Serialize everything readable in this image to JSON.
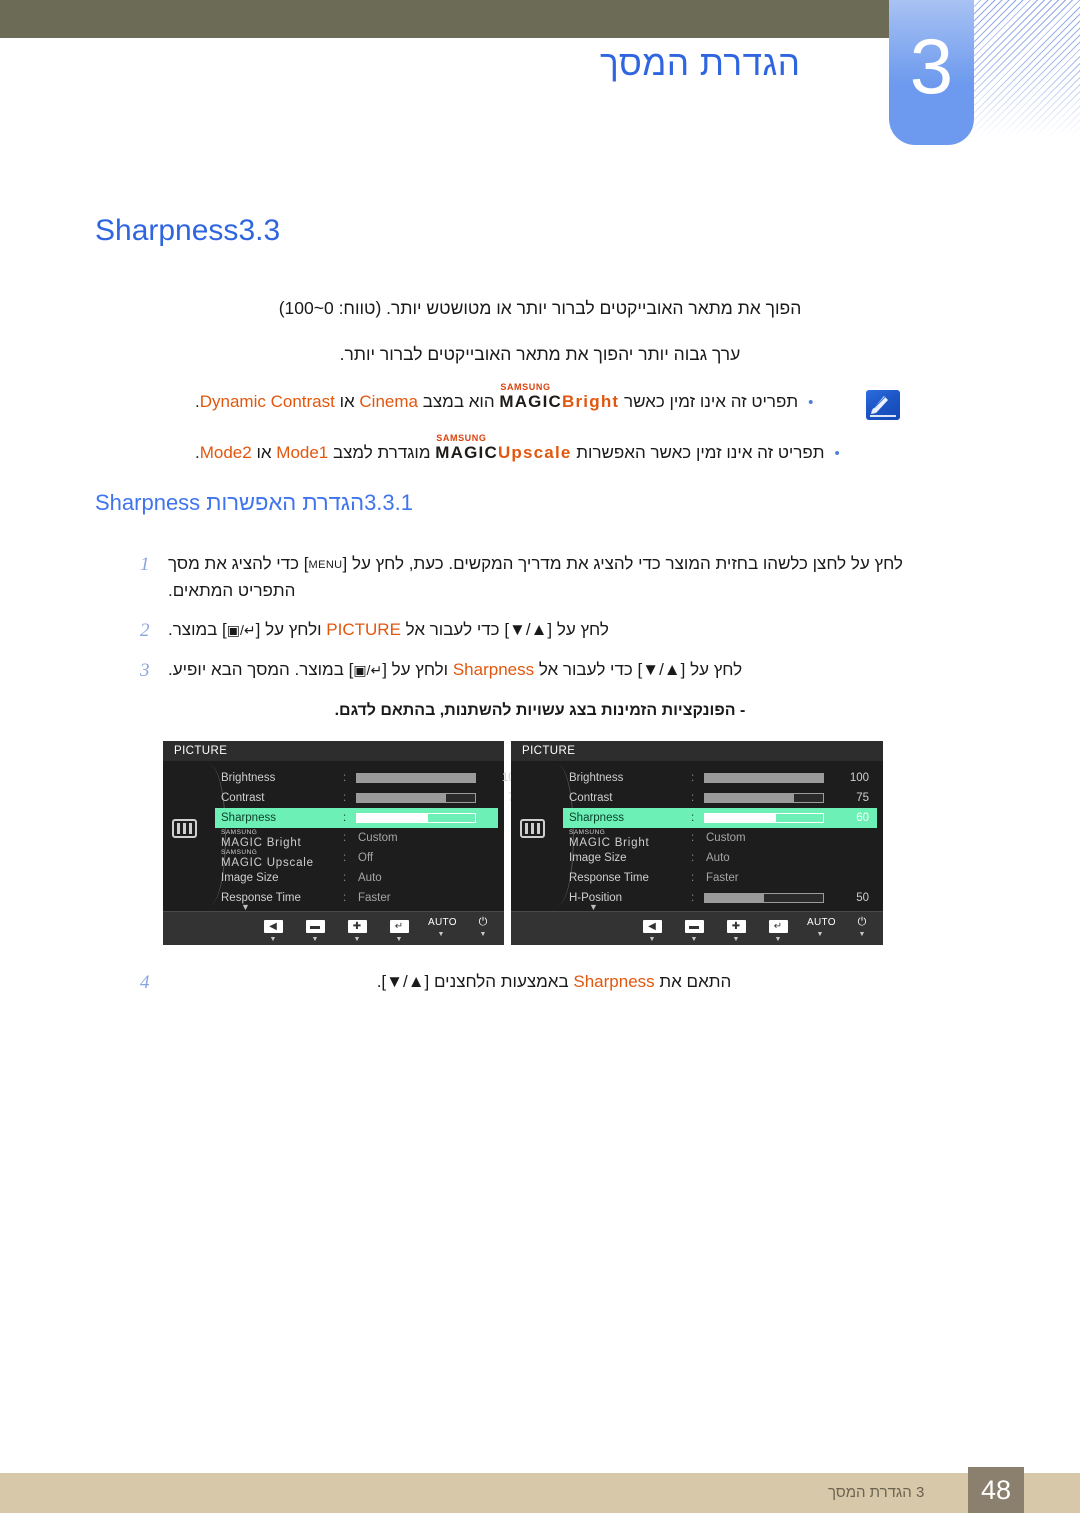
{
  "header": {
    "chapter_number": "3",
    "chapter_title": "הגדרת המסך"
  },
  "section": {
    "number": "3.3",
    "title": "Sharpness"
  },
  "body": {
    "paragraph_1": "הפוך את מתאר האובייקטים לברור יותר או מטושטש יותר. (טווח: 0~100)",
    "paragraph_2": "ערך גבוה יותר יהפוך את מתאר האובייקטים לברור יותר."
  },
  "notes": {
    "icon": "note-pencil-icon",
    "bullet_1": {
      "text_before": "תפריט זה אינו זמין כאשר",
      "magic_samsung": "SAMSUNG",
      "magic_word": "MAGIC",
      "magic_suffix": "Bright",
      "text_mid": "הוא במצב",
      "value_1": "Cinema",
      "conj": "או",
      "value_2": "Dynamic Contrast",
      "period": "."
    },
    "bullet_2": {
      "text_before": "תפריט זה אינו זמין כאשר האפשרות",
      "magic_samsung": "SAMSUNG",
      "magic_word": "MAGIC",
      "magic_suffix": "Upscale",
      "text_mid": "מוגדרת למצב",
      "value_1": "Mode1",
      "conj": "או",
      "value_2": "Mode2",
      "period": "."
    }
  },
  "subsection": {
    "number": "3.3.1",
    "title": "הגדרת האפשרות Sharpness"
  },
  "steps": [
    {
      "number": "1",
      "part_a": "לחץ על לחצן כלשהו בחזית המוצר כדי להציג את מדריך המקשים. כעת, לחץ על [",
      "key": "MENU",
      "part_b": "] כדי להציג את מסך התפריט המתאים."
    },
    {
      "number": "2",
      "part_a": "לחץ על [▲/▼] כדי לעבור אל",
      "target": "PICTURE",
      "part_b": "ולחץ על [",
      "glyph": "▣/↵",
      "part_c": "] במוצר."
    },
    {
      "number": "3",
      "part_a": "לחץ על [▲/▼] כדי לעבור אל",
      "target": "Sharpness",
      "part_b": "ולחץ על [",
      "glyph": "▣/↵",
      "part_c": "] במוצר. המסך הבא יופיע."
    },
    {
      "number": "4",
      "part_a": "התאם את",
      "target": "Sharpness",
      "part_b": "באמצעות הלחצנים [▲/▼]."
    }
  ],
  "model_note": "- הפונקציות הזמינות בצג עשויות להשתנות, בהתאם לדגם.",
  "osd_left": {
    "title": "PICTURE",
    "side_icon": "picture-menu-icon",
    "rows": [
      {
        "label": "Brightness",
        "type": "slider",
        "value": "100",
        "percent": 100
      },
      {
        "label": "Contrast",
        "type": "slider",
        "value": "75",
        "percent": 75
      },
      {
        "label": "Sharpness",
        "type": "slider",
        "value": "60",
        "percent": 60,
        "selected": true
      },
      {
        "label": "Bright",
        "type": "magic",
        "value": "Custom"
      },
      {
        "label": "Upscale",
        "type": "magic",
        "value": "Off"
      },
      {
        "label": "Image Size",
        "type": "text",
        "value": "Auto"
      },
      {
        "label": "Response Time",
        "type": "text",
        "value": "Faster"
      }
    ],
    "scroll_indicator": "▼",
    "buttons": [
      {
        "name": "back-button",
        "glyph": "◀"
      },
      {
        "name": "minus-button",
        "glyph": "▬"
      },
      {
        "name": "plus-button",
        "glyph": "✚"
      },
      {
        "name": "enter-button",
        "glyph": "↵"
      },
      {
        "name": "auto-button",
        "glyph": "AUTO"
      },
      {
        "name": "power-button",
        "glyph": "⏻"
      }
    ]
  },
  "osd_right": {
    "title": "PICTURE",
    "side_icon": "picture-menu-icon",
    "rows": [
      {
        "label": "Brightness",
        "type": "slider",
        "value": "100",
        "percent": 100
      },
      {
        "label": "Contrast",
        "type": "slider",
        "value": "75",
        "percent": 75
      },
      {
        "label": "Sharpness",
        "type": "slider",
        "value": "60",
        "percent": 60,
        "selected": true
      },
      {
        "label": "Bright",
        "type": "magic",
        "value": "Custom"
      },
      {
        "label": "Image Size",
        "type": "text",
        "value": "Auto"
      },
      {
        "label": "Response Time",
        "type": "text",
        "value": "Faster"
      },
      {
        "label": "H-Position",
        "type": "slider",
        "value": "50",
        "percent": 50
      }
    ],
    "scroll_indicator": "▼",
    "buttons": [
      {
        "name": "back-button",
        "glyph": "◀"
      },
      {
        "name": "minus-button",
        "glyph": "▬"
      },
      {
        "name": "plus-button",
        "glyph": "✚"
      },
      {
        "name": "enter-button",
        "glyph": "↵"
      },
      {
        "name": "auto-button",
        "glyph": "AUTO"
      },
      {
        "name": "power-button",
        "glyph": "⏻"
      }
    ]
  },
  "footer": {
    "page_number": "48",
    "text": "3 הגדרת המסך"
  },
  "colors": {
    "accent_blue": "#2f66e0",
    "heading_blue": "#3f74ec",
    "orange": "#e2570e",
    "header_bar": "#6c6b56",
    "footer_bar": "#d6c8a8",
    "footer_page_box": "#8b7f6d",
    "osd_highlight": "#6df0b6"
  }
}
